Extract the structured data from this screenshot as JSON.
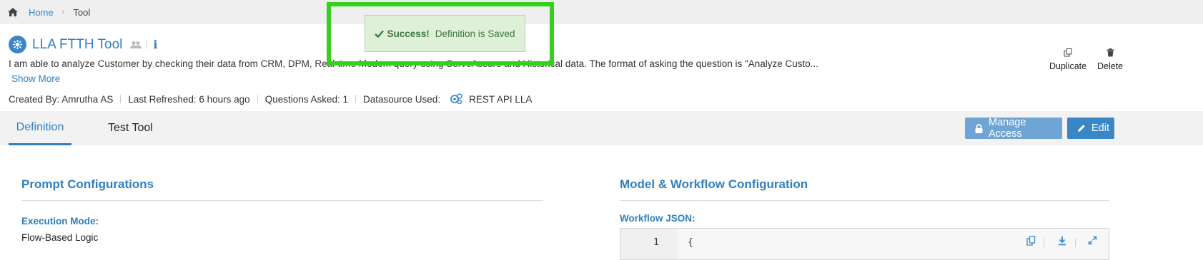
{
  "breadcrumb": {
    "home": "Home",
    "current": "Tool"
  },
  "tool": {
    "title": "LLA FTTH Tool",
    "info_glyph": "i",
    "description": "I am able to analyze Customer by checking their data from CRM, DPM, Real-time Modem query using ServeAssure and Historical data. The format of asking the question is \"Analyze Custo...",
    "show_more": "Show More"
  },
  "meta": {
    "created_by": "Created By: Amrutha AS",
    "last_refreshed": "Last Refreshed: 6 hours ago",
    "questions_asked": "Questions Asked: 1",
    "datasource_label": "Datasource Used:",
    "datasource_value": "REST API LLA"
  },
  "actions": {
    "duplicate": "Duplicate",
    "delete": "Delete"
  },
  "tabs": [
    {
      "label": "Definition",
      "active": true
    },
    {
      "label": "Test Tool",
      "active": false
    }
  ],
  "buttons": {
    "manage_access": "Manage Access",
    "edit": "Edit"
  },
  "prompt_config": {
    "title": "Prompt Configurations",
    "execution_mode_label": "Execution Mode:",
    "execution_mode_value": "Flow-Based Logic"
  },
  "model_config": {
    "title": "Model & Workflow Configuration",
    "workflow_json_label": "Workflow JSON:",
    "code_line_number": "1",
    "code_line_text": "{"
  },
  "toast": {
    "strong": "Success!",
    "message": "Definition is Saved"
  },
  "colors": {
    "accent": "#2f7fc1",
    "highlight": "#35d01c",
    "success_bg": "#dff0d8",
    "success_text": "#3c763d"
  },
  "icons": [
    "home-icon",
    "tool-logo-icon",
    "users-icon",
    "info-icon",
    "datasource-icon",
    "duplicate-icon",
    "delete-icon",
    "lock-icon",
    "pencil-icon",
    "check-icon",
    "copy-icon",
    "download-icon",
    "expand-icon"
  ]
}
